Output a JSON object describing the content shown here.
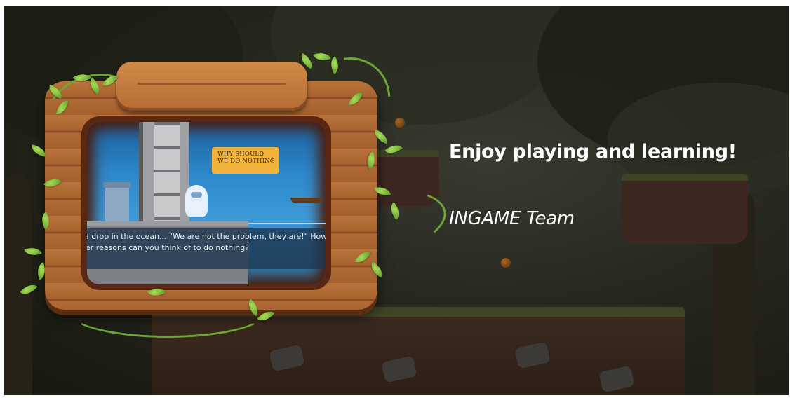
{
  "message": {
    "headline": "Enjoy playing and learning!",
    "signature": "INGAME Team"
  },
  "game_preview": {
    "speech_bubble": [
      "WHY SHOULD",
      "WE DO NOTHING"
    ],
    "dialog_lines": [
      "a drop in the ocean... \"We are not the problem, they are!\" How",
      "er reasons can you think of to do nothing?"
    ]
  },
  "colors": {
    "text": "#ffffff",
    "wood": "#b06b35",
    "leaf": "#7fbf3f",
    "background": "#26271f"
  }
}
